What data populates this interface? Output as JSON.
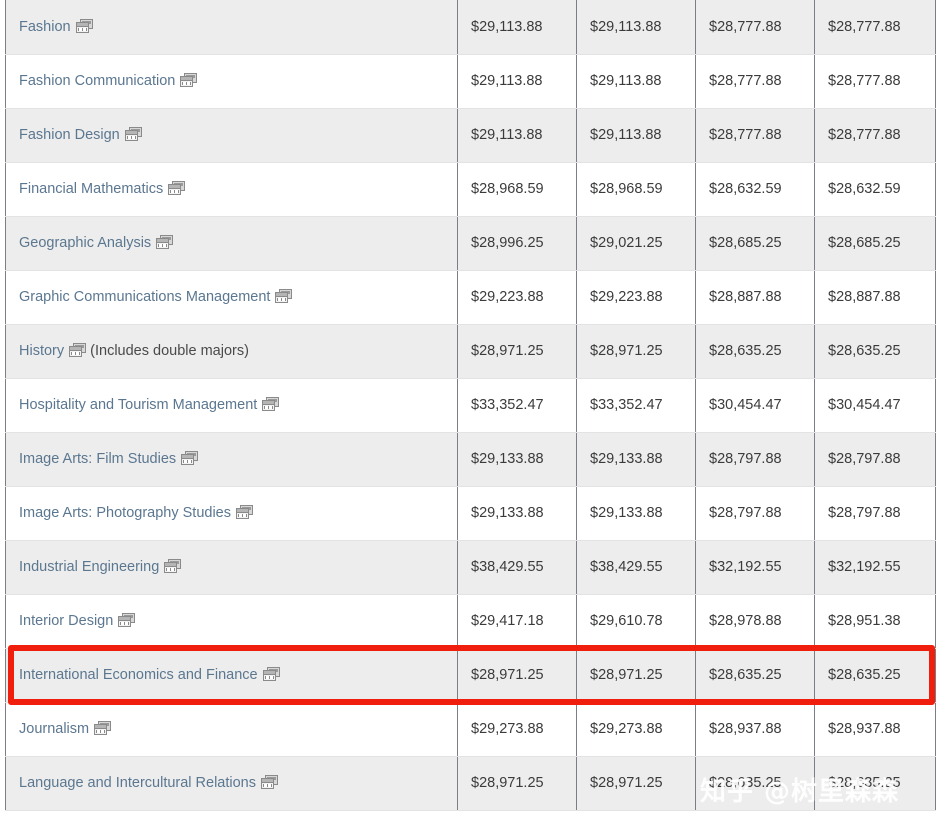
{
  "table": {
    "columns": [
      "program",
      "value_1",
      "value_2",
      "value_3",
      "value_4"
    ],
    "icon_name": "compare-programs-icon",
    "rows": [
      {
        "program": "Fashion",
        "note": "",
        "values": [
          "$29,113.88",
          "$29,113.88",
          "$28,777.88",
          "$28,777.88"
        ],
        "shaded": true,
        "highlighted": false
      },
      {
        "program": "Fashion Communication",
        "note": "",
        "values": [
          "$29,113.88",
          "$29,113.88",
          "$28,777.88",
          "$28,777.88"
        ],
        "shaded": false,
        "highlighted": false
      },
      {
        "program": "Fashion Design",
        "note": "",
        "values": [
          "$29,113.88",
          "$29,113.88",
          "$28,777.88",
          "$28,777.88"
        ],
        "shaded": true,
        "highlighted": false
      },
      {
        "program": "Financial Mathematics",
        "note": "",
        "values": [
          "$28,968.59",
          "$28,968.59",
          "$28,632.59",
          "$28,632.59"
        ],
        "shaded": false,
        "highlighted": false
      },
      {
        "program": "Geographic Analysis",
        "note": "",
        "values": [
          "$28,996.25",
          "$29,021.25",
          "$28,685.25",
          "$28,685.25"
        ],
        "shaded": true,
        "highlighted": false
      },
      {
        "program": "Graphic Communications Management",
        "note": "",
        "values": [
          "$29,223.88",
          "$29,223.88",
          "$28,887.88",
          "$28,887.88"
        ],
        "shaded": false,
        "highlighted": false
      },
      {
        "program": "History",
        "note": "(Includes double majors)",
        "values": [
          "$28,971.25",
          "$28,971.25",
          "$28,635.25",
          "$28,635.25"
        ],
        "shaded": true,
        "highlighted": false
      },
      {
        "program": "Hospitality and Tourism Management",
        "note": "",
        "values": [
          "$33,352.47",
          "$33,352.47",
          "$30,454.47",
          "$30,454.47"
        ],
        "shaded": false,
        "highlighted": false
      },
      {
        "program": "Image Arts: Film Studies",
        "note": "",
        "values": [
          "$29,133.88",
          "$29,133.88",
          "$28,797.88",
          "$28,797.88"
        ],
        "shaded": true,
        "highlighted": false
      },
      {
        "program": "Image Arts: Photography Studies",
        "note": "",
        "values": [
          "$29,133.88",
          "$29,133.88",
          "$28,797.88",
          "$28,797.88"
        ],
        "shaded": false,
        "highlighted": false
      },
      {
        "program": "Industrial Engineering",
        "note": "",
        "values": [
          "$38,429.55",
          "$38,429.55",
          "$32,192.55",
          "$32,192.55"
        ],
        "shaded": true,
        "highlighted": false
      },
      {
        "program": "Interior Design",
        "note": "",
        "values": [
          "$29,417.18",
          "$29,610.78",
          "$28,978.88",
          "$28,951.38"
        ],
        "shaded": false,
        "highlighted": false
      },
      {
        "program": "International Economics and Finance",
        "note": "",
        "values": [
          "$28,971.25",
          "$28,971.25",
          "$28,635.25",
          "$28,635.25"
        ],
        "shaded": true,
        "highlighted": true
      },
      {
        "program": "Journalism",
        "note": "",
        "values": [
          "$29,273.88",
          "$29,273.88",
          "$28,937.88",
          "$28,937.88"
        ],
        "shaded": false,
        "highlighted": false
      },
      {
        "program": "Language and Intercultural Relations",
        "note": "",
        "values": [
          "$28,971.25",
          "$28,971.25",
          "$28,635.25",
          "$28,635.25"
        ],
        "shaded": true,
        "highlighted": false
      }
    ]
  },
  "annotation": {
    "highlight_color": "#f01f0d",
    "highlight_row_index": 12
  },
  "watermark": {
    "text": "知乎 @树里森森"
  }
}
